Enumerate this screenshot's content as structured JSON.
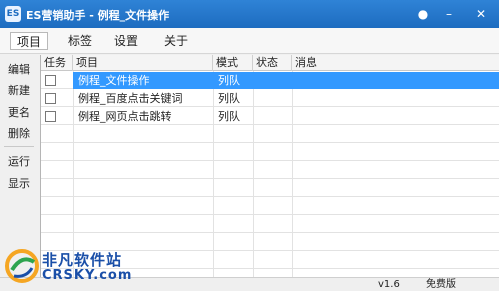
{
  "window": {
    "title": "ES营销助手 - 例程_文件操作",
    "app_icon_text": "ES"
  },
  "menu": [
    "项目",
    "标签",
    "设置",
    "关于"
  ],
  "sidebar": [
    "编辑",
    "新建",
    "更名",
    "删除",
    "运行",
    "显示"
  ],
  "table": {
    "columns": [
      "任务",
      "项目",
      "模式",
      "状态",
      "消息"
    ],
    "rows": [
      {
        "task": "",
        "project": "例程_文件操作",
        "mode": "列队",
        "status": "",
        "message": "",
        "selected": true
      },
      {
        "task": "",
        "project": "例程_百度点击关键词",
        "mode": "列队",
        "status": "",
        "message": "",
        "selected": false
      },
      {
        "task": "",
        "project": "例程_网页点击跳转",
        "mode": "列队",
        "status": "",
        "message": "",
        "selected": false
      }
    ]
  },
  "status": {
    "version": "v1.6",
    "edition": "免费版"
  },
  "watermark": {
    "cn": "非凡软件站",
    "en": "CRSKY.com"
  },
  "colors": {
    "titlebar": "#1d6cc0",
    "selection": "#3399ff"
  }
}
